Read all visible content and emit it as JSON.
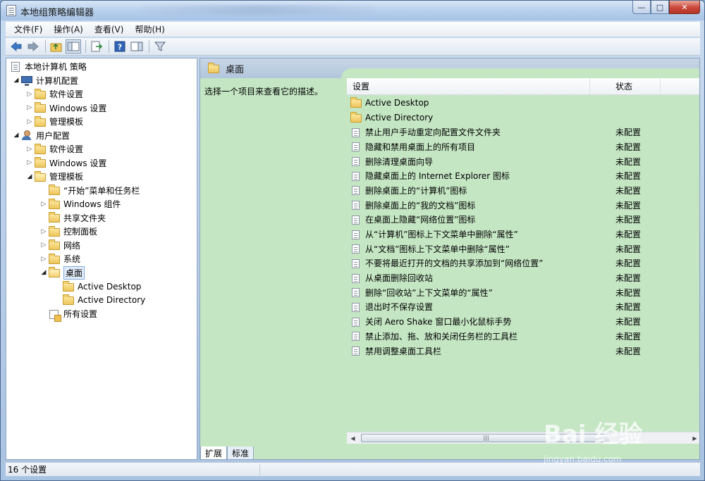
{
  "window": {
    "title": "本地组策略编辑器"
  },
  "menu": [
    {
      "label": "文件(F)"
    },
    {
      "label": "操作(A)"
    },
    {
      "label": "查看(V)"
    },
    {
      "label": "帮助(H)"
    }
  ],
  "toolbar": {
    "buttons": [
      "back-icon",
      "forward-icon",
      "up-folder-icon",
      "show-hide-tree-icon",
      "export-list-icon",
      "help-icon",
      "action-pane-icon",
      "filter-icon"
    ]
  },
  "tree": {
    "root": "本地计算机 策略",
    "computer_config": "计算机配置",
    "cc_software": "软件设置",
    "cc_windows": "Windows 设置",
    "cc_admin": "管理模板",
    "user_config": "用户配置",
    "uc_software": "软件设置",
    "uc_windows": "Windows 设置",
    "uc_admin": "管理模板",
    "start_menu": "“开始”菜单和任务栏",
    "win_components": "Windows 组件",
    "shared_folders": "共享文件夹",
    "control_panel": "控制面板",
    "network": "网络",
    "system": "系统",
    "desktop": "桌面",
    "active_desktop": "Active Desktop",
    "active_directory": "Active Directory",
    "all_settings": "所有设置"
  },
  "right": {
    "header": "桌面",
    "description": "选择一个项目来查看它的描述。",
    "col_setting": "设置",
    "col_state": "状态",
    "rows": [
      {
        "name": "Active Desktop",
        "state": "",
        "type": "folder"
      },
      {
        "name": "Active Directory",
        "state": "",
        "type": "folder"
      },
      {
        "name": "禁止用户手动重定向配置文件文件夹",
        "state": "未配置",
        "type": "setting"
      },
      {
        "name": "隐藏和禁用桌面上的所有项目",
        "state": "未配置",
        "type": "setting"
      },
      {
        "name": "删除清理桌面向导",
        "state": "未配置",
        "type": "setting"
      },
      {
        "name": "隐藏桌面上的 Internet Explorer 图标",
        "state": "未配置",
        "type": "setting"
      },
      {
        "name": "删除桌面上的“计算机”图标",
        "state": "未配置",
        "type": "setting"
      },
      {
        "name": "删除桌面上的“我的文档”图标",
        "state": "未配置",
        "type": "setting"
      },
      {
        "name": "在桌面上隐藏“网络位置”图标",
        "state": "未配置",
        "type": "setting"
      },
      {
        "name": "从“计算机”图标上下文菜单中删除“属性”",
        "state": "未配置",
        "type": "setting"
      },
      {
        "name": "从“文档”图标上下文菜单中删除“属性”",
        "state": "未配置",
        "type": "setting"
      },
      {
        "name": "不要将最近打开的文档的共享添加到“网络位置”",
        "state": "未配置",
        "type": "setting"
      },
      {
        "name": "从桌面删除回收站",
        "state": "未配置",
        "type": "setting"
      },
      {
        "name": "删除“回收站”上下文菜单的“属性”",
        "state": "未配置",
        "type": "setting"
      },
      {
        "name": "退出时不保存设置",
        "state": "未配置",
        "type": "setting"
      },
      {
        "name": "关闭 Aero Shake 窗口最小化鼠标手势",
        "state": "未配置",
        "type": "setting"
      },
      {
        "name": "禁止添加、拖、放和关闭任务栏的工具栏",
        "state": "未配置",
        "type": "setting"
      },
      {
        "name": "禁用调整桌面工具栏",
        "state": "未配置",
        "type": "setting"
      }
    ],
    "tab_extended": "扩展",
    "tab_standard": "标准"
  },
  "status": {
    "text": "16 个设置"
  },
  "watermark": {
    "main": "Bai 经验",
    "sub": "jingyan.baidu.com"
  },
  "colors": {
    "pane_green": "#c4e6c3",
    "header_blue": "#b2c6dc"
  }
}
